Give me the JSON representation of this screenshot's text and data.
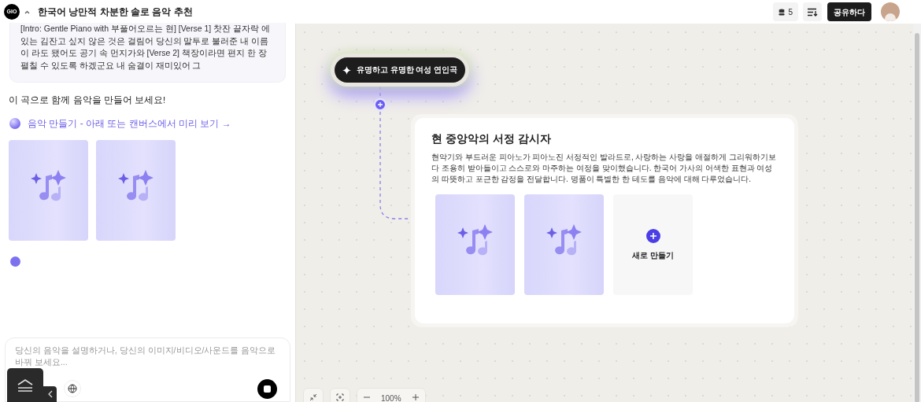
{
  "header": {
    "logo": "GIO",
    "title": "한국어 낭만적 차분한 솔로 음악 추천",
    "credits": "5",
    "share_button": "공유하다"
  },
  "chat": {
    "lyrics": "[Intro: Gentle Piano with 부풀어오르는 현] [Verse 1] 찻잔 끝자락 에 있는 김잔고 싶지 않은 것은 걸림어 당신의 말투로 불러준 내 이름이 라도 됐어도 공기 속 먼지가와 [Verse 2] 책장이라면 편지 한 장 펼칠 수 있도록 하겠군요 내 숨결이 재미있어 그",
    "message": "이 곡으로 함께 음악을 만들어 보세요!",
    "create_link": "음악 만들기 - 아래 또는 캔버스에서 미리 보기 →",
    "thumbnails": [
      {
        "kind": "song"
      },
      {
        "kind": "song"
      }
    ],
    "loading": true,
    "input": {
      "placeholder": "당신의 음악을 설명하거나, 당신의 이미지/비디오/사운드를 음악으로 바꿔 보세요..."
    }
  },
  "canvas": {
    "prompt_node": "유명하고 유명한 여성 연인곡",
    "card": {
      "title": "현 중앙악의 서정 감시자",
      "description": "현악기와 부드러운 피아노가 피아노진 서정적인 발라드로, 사랑하는 사랑을 애절하게 그리워하기보다 조용히 받아들이고 스스로와 마주하는 여정을 맞이했습니다. 한국어 가사의 어색한 표현과 여성의 따뜻하고 포근한 감정을 전달합니다. 명품이 특별한 한 테도를 음악에 대해 다루었습니다.",
      "tiles": [
        {
          "kind": "song"
        },
        {
          "kind": "song"
        },
        {
          "kind": "new",
          "label": "새로 만들기"
        }
      ]
    },
    "zoom": "100%"
  }
}
